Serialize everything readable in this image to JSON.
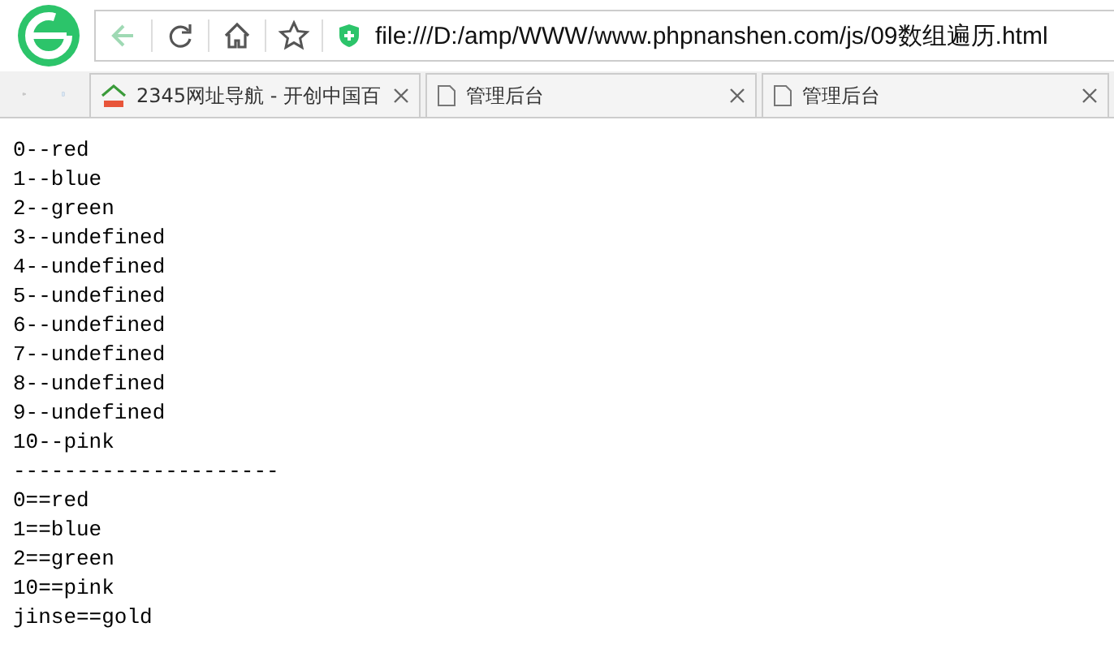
{
  "address_bar": {
    "url": "file:///D:/amp/WWW/www.phpnanshen.com/js/09数组遍历.html"
  },
  "tabs": [
    {
      "title": "2345网址导航 - 开创中国百",
      "kind": "site"
    },
    {
      "title": "管理后台",
      "kind": "page"
    },
    {
      "title": "管理后台",
      "kind": "page"
    }
  ],
  "output_lines": [
    "0--red",
    "1--blue",
    "2--green",
    "3--undefined",
    "4--undefined",
    "5--undefined",
    "6--undefined",
    "7--undefined",
    "8--undefined",
    "9--undefined",
    "10--pink",
    "---------------------",
    "0==red",
    "1==blue",
    "2==green",
    "10==pink",
    "jinse==gold"
  ]
}
